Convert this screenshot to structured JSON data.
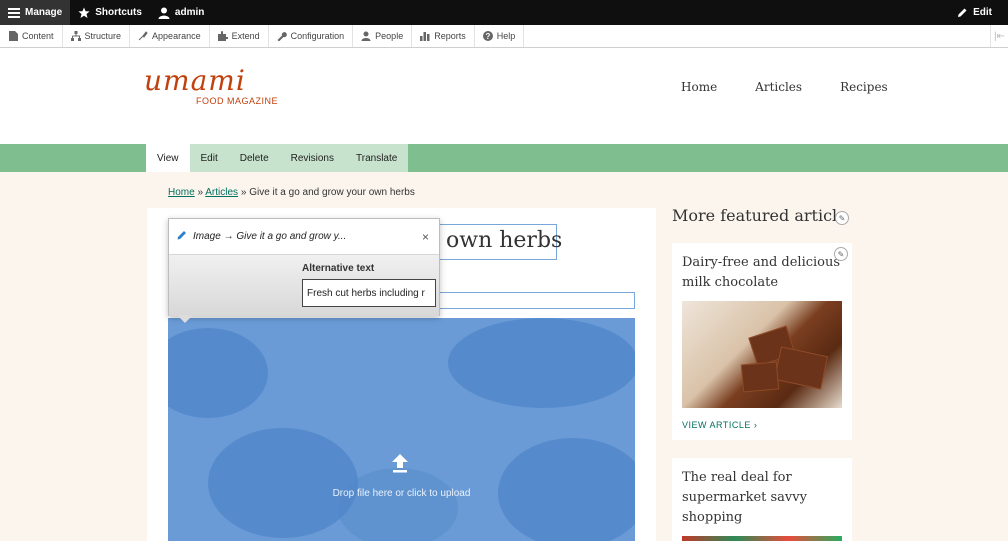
{
  "toolbar": {
    "manage": "Manage",
    "shortcuts": "Shortcuts",
    "user": "admin",
    "edit": "Edit"
  },
  "tray": {
    "items": [
      {
        "label": "Content",
        "icon": "content-icon"
      },
      {
        "label": "Structure",
        "icon": "structure-icon"
      },
      {
        "label": "Appearance",
        "icon": "appearance-icon"
      },
      {
        "label": "Extend",
        "icon": "extend-icon"
      },
      {
        "label": "Configuration",
        "icon": "wrench-icon"
      },
      {
        "label": "People",
        "icon": "person-icon"
      },
      {
        "label": "Reports",
        "icon": "bar-chart-icon"
      },
      {
        "label": "Help",
        "icon": "help-icon"
      }
    ]
  },
  "site": {
    "logo_name": "umami",
    "logo_tagline": "FOOD MAGAZINE",
    "nav": [
      "Home",
      "Articles",
      "Recipes"
    ]
  },
  "tabs": [
    "View",
    "Edit",
    "Delete",
    "Revisions",
    "Translate"
  ],
  "breadcrumb": {
    "home": "Home",
    "sep1": "»",
    "articles": "Articles",
    "sep2": "»",
    "current": "Give it a go and grow your own herbs"
  },
  "article": {
    "title_visible": "own herbs",
    "upload_hint": "Drop file here or click to upload"
  },
  "balloon": {
    "heading": "Image → Give it a go and grow y...",
    "close": "×",
    "alt_label": "Alternative text",
    "alt_value": "Fresh cut herbs including r"
  },
  "sidebar": {
    "title": "More featured article",
    "cards": [
      {
        "title": "Dairy-free and delicious milk chocolate",
        "link": "VIEW ARTICLE"
      },
      {
        "title": "The real deal for supermarket savvy shopping"
      }
    ]
  },
  "colors": {
    "accent_green": "#7fbf8f",
    "link_green": "#00715e",
    "brand_orange": "#c1410e",
    "selection_blue": "#6a9bd6"
  }
}
